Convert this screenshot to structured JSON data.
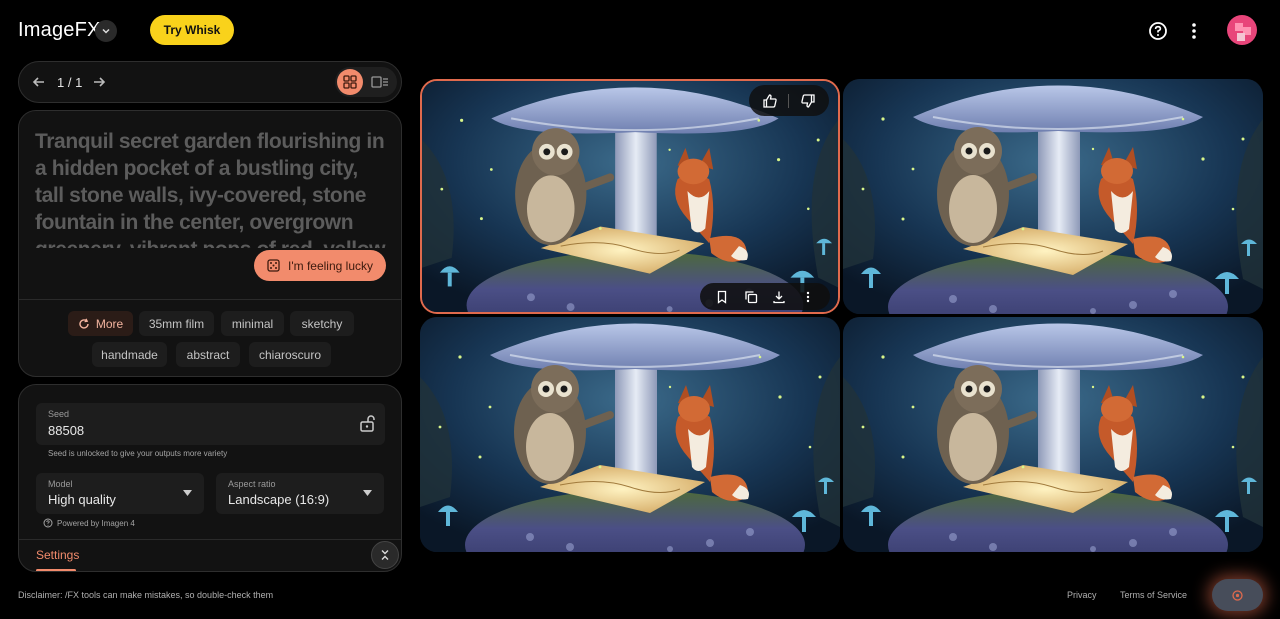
{
  "header": {
    "logo": "ImageFX",
    "try_whisk": "Try Whisk"
  },
  "pager": {
    "count": "1 / 1"
  },
  "prompt": {
    "text": "Tranquil secret garden flourishing in a hidden pocket of a bustling city, tall stone walls, ivy-covered, stone fountain in the center, overgrown greenery, vibrant pops of red, yellow",
    "lucky_label": "I'm feeling lucky"
  },
  "chips": [
    {
      "label": "More"
    },
    {
      "label": "35mm film"
    },
    {
      "label": "minimal"
    },
    {
      "label": "sketchy"
    },
    {
      "label": "handmade"
    },
    {
      "label": "abstract"
    },
    {
      "label": "chiaroscuro"
    }
  ],
  "settings": {
    "seed_label": "Seed",
    "seed_value": "88508",
    "seed_hint": "Seed is unlocked to give your outputs more variety",
    "model_label": "Model",
    "model_value": "High quality",
    "aspect_label": "Aspect ratio",
    "aspect_value": "Landscape (16:9)",
    "powered_by": "Powered by Imagen 4",
    "tab_label": "Settings"
  },
  "images": [
    {
      "name": "generated-image-1",
      "selected": true
    },
    {
      "name": "generated-image-2",
      "selected": false
    },
    {
      "name": "generated-image-3",
      "selected": false
    },
    {
      "name": "generated-image-4",
      "selected": false
    }
  ],
  "footer": {
    "disclaimer": "Disclaimer: /FX tools can make mistakes, so double-check them",
    "privacy": "Privacy",
    "terms": "Terms of Service"
  },
  "colors": {
    "accent": "#f28b6c",
    "whisk": "#f9d21b",
    "background": "#000000",
    "panel": "#121212"
  }
}
